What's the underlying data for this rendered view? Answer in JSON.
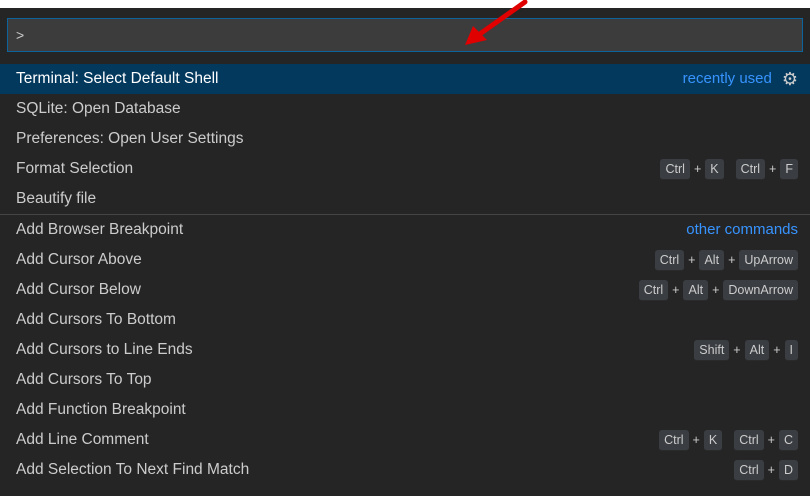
{
  "input": {
    "value": ">"
  },
  "items": [
    {
      "label": "Terminal: Select Default Shell",
      "meta": "recently used",
      "gear": true,
      "selected": true,
      "chords": []
    },
    {
      "label": "SQLite: Open Database",
      "chords": []
    },
    {
      "label": "Preferences: Open User Settings",
      "chords": []
    },
    {
      "label": "Format Selection",
      "chords": [
        [
          "Ctrl",
          "K"
        ],
        [
          "Ctrl",
          "F"
        ]
      ]
    },
    {
      "label": "Beautify file",
      "chords": []
    },
    {
      "label": "Add Browser Breakpoint",
      "meta": "other commands",
      "separator": true,
      "chords": []
    },
    {
      "label": "Add Cursor Above",
      "chords": [
        [
          "Ctrl",
          "Alt",
          "UpArrow"
        ]
      ]
    },
    {
      "label": "Add Cursor Below",
      "chords": [
        [
          "Ctrl",
          "Alt",
          "DownArrow"
        ]
      ]
    },
    {
      "label": "Add Cursors To Bottom",
      "chords": []
    },
    {
      "label": "Add Cursors to Line Ends",
      "chords": [
        [
          "Shift",
          "Alt",
          "I"
        ]
      ]
    },
    {
      "label": "Add Cursors To Top",
      "chords": []
    },
    {
      "label": "Add Function Breakpoint",
      "chords": []
    },
    {
      "label": "Add Line Comment",
      "chords": [
        [
          "Ctrl",
          "K"
        ],
        [
          "Ctrl",
          "C"
        ]
      ]
    },
    {
      "label": "Add Selection To Next Find Match",
      "chords": [
        [
          "Ctrl",
          "D"
        ]
      ]
    }
  ],
  "colors": {
    "accent": "#3794ff",
    "selected_bg": "#04395e",
    "arrow": "#e00000"
  },
  "icons": {
    "gear": "gear-icon",
    "annotation": "red-arrow-icon"
  }
}
